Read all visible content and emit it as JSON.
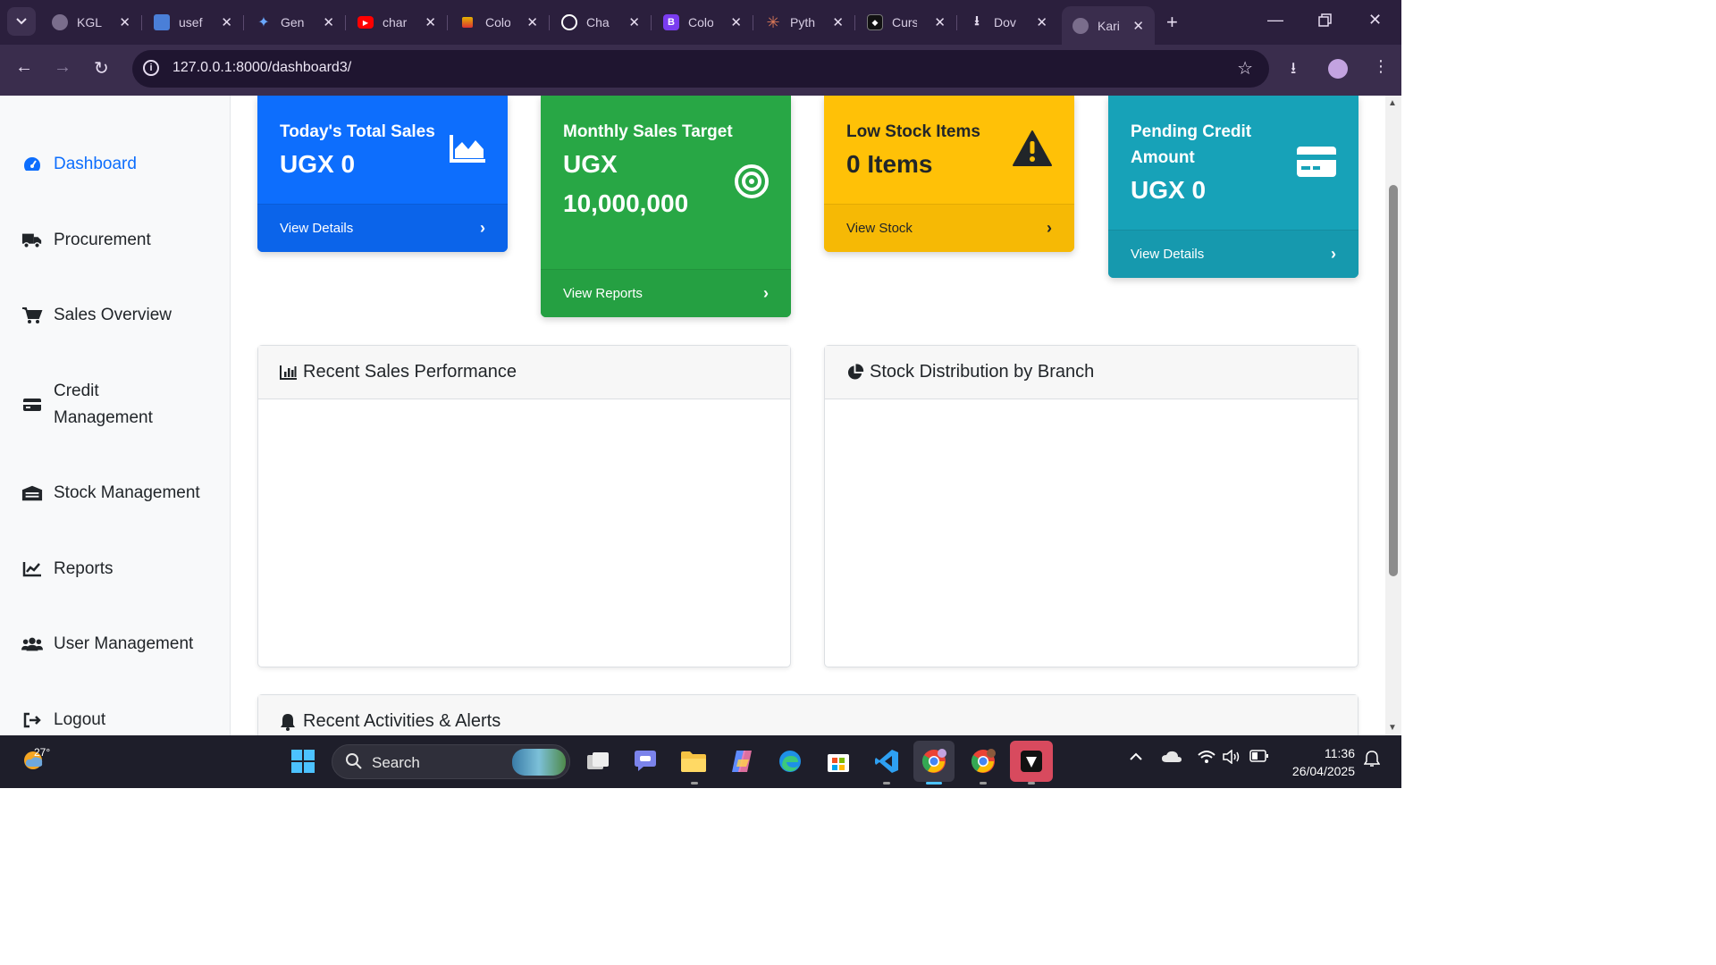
{
  "browser": {
    "tabs": [
      {
        "title": "KGL",
        "icon": "globe-icon",
        "color": "#7a6d8c"
      },
      {
        "title": "usef",
        "icon": "contacts-icon",
        "color": "#4a7fd8"
      },
      {
        "title": "Gen",
        "icon": "sparkle-icon",
        "color": "#6aa7ff"
      },
      {
        "title": "char",
        "icon": "youtube-icon",
        "color": "#ff0000"
      },
      {
        "title": "Colo",
        "icon": "colors-icon",
        "color": "#e5b400"
      },
      {
        "title": "Cha",
        "icon": "chatgpt-icon",
        "color": "#ffffff"
      },
      {
        "title": "Colo",
        "icon": "bootstrap-icon",
        "color": "#7a3cf0"
      },
      {
        "title": "Pyth",
        "icon": "claude-icon",
        "color": "#d97757"
      },
      {
        "title": "Curs",
        "icon": "cursor-icon",
        "color": "#111111"
      },
      {
        "title": "Dov",
        "icon": "download-icon",
        "color": "#e6dcf0"
      },
      {
        "title": "Kari",
        "icon": "globe-icon",
        "color": "#7a6d8c"
      }
    ],
    "url": "127.0.0.1:8000/dashboard3/"
  },
  "sidebar": {
    "items": [
      {
        "label": "Dashboard",
        "icon": "tachometer-icon",
        "active": true
      },
      {
        "label": "Procurement",
        "icon": "truck-icon"
      },
      {
        "label": "Sales Overview",
        "icon": "cart-icon"
      },
      {
        "label": "Credit Management",
        "icon": "credit-card-icon"
      },
      {
        "label": "Stock Management",
        "icon": "warehouse-icon"
      },
      {
        "label": "Reports",
        "icon": "line-chart-icon"
      },
      {
        "label": "User Management",
        "icon": "users-icon"
      },
      {
        "label": "Logout",
        "icon": "sign-out-icon"
      }
    ]
  },
  "cards": {
    "sales": {
      "title": "Today's Total Sales",
      "value": "UGX 0",
      "link": "View Details",
      "color": "#0d6efd",
      "icon": "area-chart-icon"
    },
    "target": {
      "title": "Monthly Sales Target",
      "value": "UGX 10,000,000",
      "link": "View Reports",
      "color": "#28a745",
      "icon": "bullseye-icon"
    },
    "lowstock": {
      "title": "Low Stock Items",
      "value": "0 Items",
      "link": "View Stock",
      "color": "#ffc107",
      "icon": "warning-icon"
    },
    "credit": {
      "title": "Pending Credit Amount",
      "value": "UGX 0",
      "link": "View Details",
      "color": "#17a2b8",
      "icon": "credit-card-icon"
    }
  },
  "panels": {
    "sales_perf": "Recent Sales Performance",
    "stock_dist": "Stock Distribution by Branch",
    "activities": "Recent Activities & Alerts"
  },
  "taskbar": {
    "temperature": "27°",
    "search_placeholder": "Search",
    "time": "11:36",
    "date": "26/04/2025"
  }
}
